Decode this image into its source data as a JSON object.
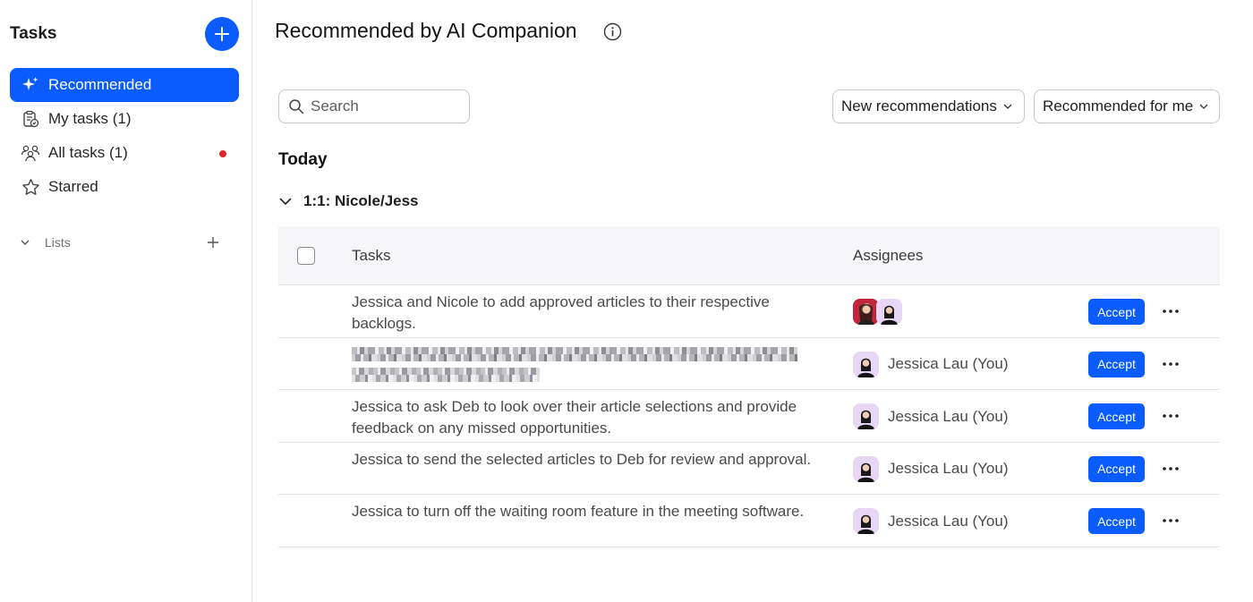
{
  "sidebar": {
    "title": "Tasks",
    "items": [
      {
        "label": "Recommended",
        "icon": "sparkle-icon",
        "active": true
      },
      {
        "label": "My tasks (1)",
        "icon": "clipboard-check-icon"
      },
      {
        "label": "All tasks (1)",
        "icon": "people-icon"
      },
      {
        "label": "Starred",
        "icon": "star-icon"
      }
    ],
    "lists_label": "Lists"
  },
  "main": {
    "title": "Recommended by AI Companion",
    "search_placeholder": "Search",
    "filter_1": "New recommendations",
    "filter_2": "Recommended for me",
    "section": "Today",
    "group": "1:1: Nicole/Jess",
    "columns": {
      "tasks": "Tasks",
      "assignees": "Assignees"
    },
    "accept_label": "Accept",
    "rows": [
      {
        "text": "Jessica and Nicole to add approved articles to their respective backlogs.",
        "assignee": ""
      },
      {
        "text": "",
        "assignee": "Jessica Lau (You)"
      },
      {
        "text": "Jessica to ask Deb to look over their article selections and provide feedback on any missed opportunities.",
        "assignee": "Jessica Lau (You)"
      },
      {
        "text": "Jessica to send the selected articles to Deb for review and approval.",
        "assignee": "Jessica Lau (You)"
      },
      {
        "text": "Jessica to turn off the waiting room feature in the meeting software.",
        "assignee": "Jessica Lau (You)"
      }
    ]
  },
  "colors": {
    "accent": "#0b5cff",
    "notification_dot": "#e02828"
  }
}
